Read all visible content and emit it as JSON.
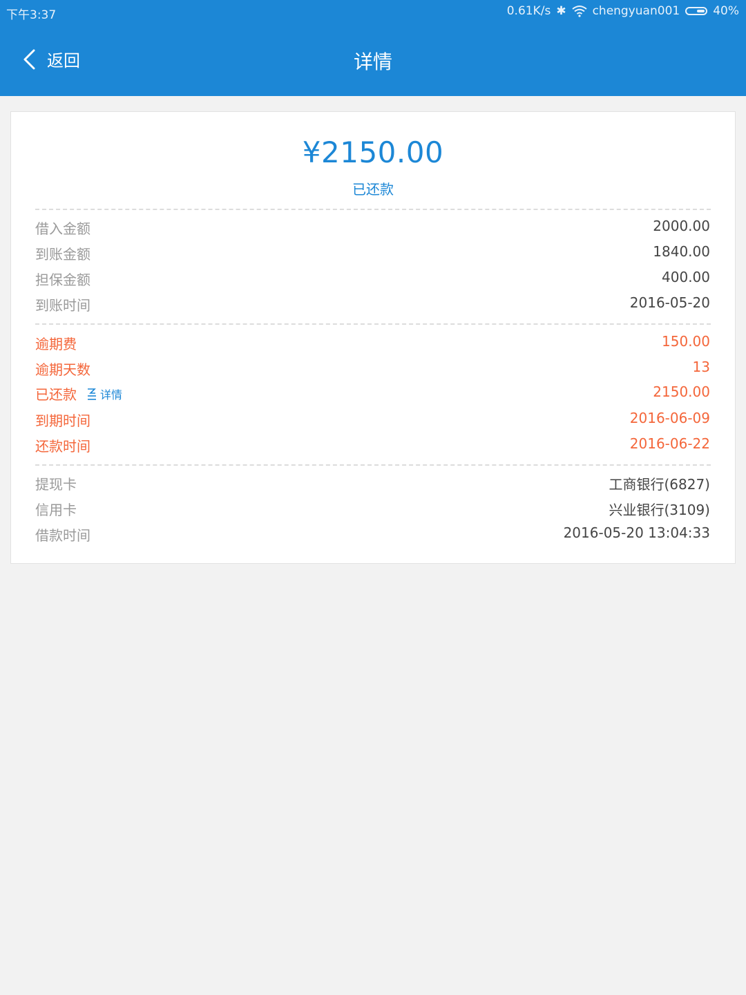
{
  "status_bar": {
    "time": "下午3:37",
    "network_speed": "0.61K/s",
    "bluetooth_icon": "bluetooth-icon",
    "wifi_icon": "wifi-icon",
    "account": "chengyuan001",
    "battery": "40%",
    "battery_level": 0.4
  },
  "nav": {
    "back_label": "返回",
    "title": "详情"
  },
  "summary": {
    "amount": "¥2150.00",
    "status": "已还款"
  },
  "loan_section": [
    {
      "label": "借入金额",
      "value": "2000.00"
    },
    {
      "label": "到账金额",
      "value": "1840.00"
    },
    {
      "label": "担保金额",
      "value": "400.00"
    },
    {
      "label": "到账时间",
      "value": "2016-05-20"
    }
  ],
  "repay_section": [
    {
      "label": "逾期费",
      "value": "150.00"
    },
    {
      "label": "逾期天数",
      "value": "13"
    },
    {
      "label": "已还款",
      "value": "2150.00",
      "link": "详情"
    },
    {
      "label": "到期时间",
      "value": "2016-06-09"
    },
    {
      "label": "还款时间",
      "value": "2016-06-22"
    }
  ],
  "card_section": [
    {
      "label": "提现卡",
      "value": "工商银行(6827)"
    },
    {
      "label": "信用卡",
      "value": "兴业银行(3109)"
    },
    {
      "label": "借款时间",
      "value": "2016-05-20 13:04:33"
    }
  ],
  "colors": {
    "header": "#1c87d6",
    "accent": "#1c87d6",
    "overdue": "#f4663a",
    "background": "#f2f2f2"
  }
}
